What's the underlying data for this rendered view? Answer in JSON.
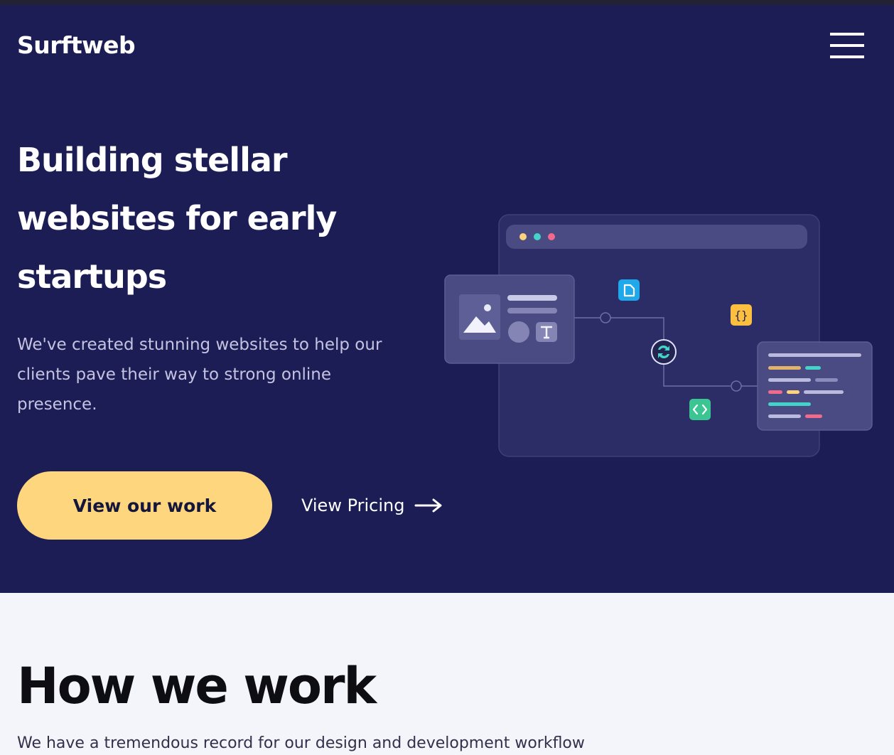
{
  "brand": {
    "name": "Surftweb"
  },
  "nav": {
    "menu_icon": "hamburger-menu-icon"
  },
  "hero": {
    "title": "Building stellar websites for early startups",
    "description": "We've created stunning websites to help our clients pave their way to strong online presence.",
    "primary_cta": "View our work",
    "secondary_cta": "View Pricing",
    "secondary_cta_icon": "arrow-right-icon"
  },
  "how_we_work": {
    "title": "How we work",
    "intro": "We have a tremendous record for our design and development workflow"
  },
  "colors": {
    "hero_bg": "#1c1d55",
    "accent": "#fdd67e",
    "page_bg": "#f4f5fb",
    "window_bg": "#2c2d66",
    "dot_yellow": "#fcd37c",
    "dot_teal": "#44d3c9",
    "dot_pink": "#f16a8c"
  },
  "illustration_icons": [
    "image-icon",
    "text-icon",
    "file-icon",
    "code-braces-icon",
    "sync-icon",
    "code-tag-icon"
  ]
}
